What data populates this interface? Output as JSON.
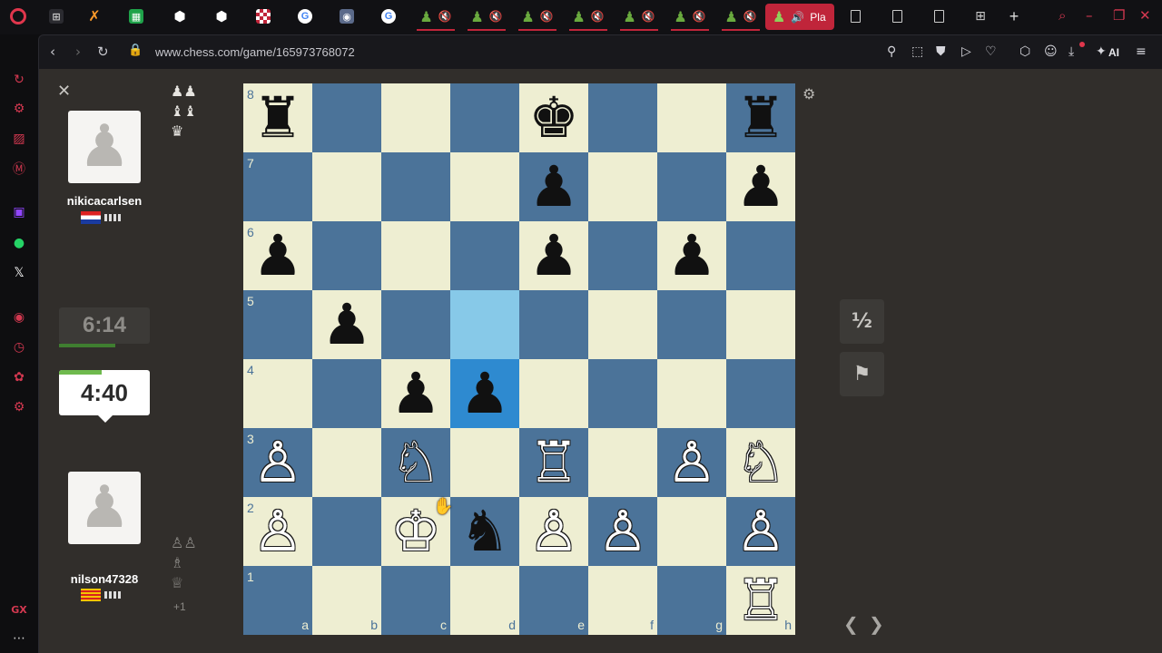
{
  "browser": {
    "active_tab_label": "Pla",
    "url": "www.chess.com/game/165973768072",
    "ai_label": "AI",
    "pawn_tab_glyph": "♟",
    "mute_glyph": "🔇"
  },
  "game": {
    "top_player": {
      "name": "nikicacarlsen",
      "clock": "6:14",
      "captured": [
        "♟♟",
        "♝♝",
        "♛"
      ]
    },
    "bottom_player": {
      "name": "nilson47328",
      "clock": "4:40",
      "captured": [
        "♙♙",
        "♗",
        "♕"
      ],
      "captured_extra": "+1"
    },
    "draw_label": "½",
    "ranks": [
      "8",
      "7",
      "6",
      "5",
      "4",
      "3",
      "2",
      "1"
    ],
    "files": [
      "a",
      "b",
      "c",
      "d",
      "e",
      "f",
      "g",
      "h"
    ],
    "pieces": [
      {
        "square": "a8",
        "glyph": "♜",
        "color": "b"
      },
      {
        "square": "e8",
        "glyph": "♚",
        "color": "b"
      },
      {
        "square": "h8",
        "glyph": "♜",
        "color": "b"
      },
      {
        "square": "e7",
        "glyph": "♟",
        "color": "b"
      },
      {
        "square": "h7",
        "glyph": "♟",
        "color": "b"
      },
      {
        "square": "a6",
        "glyph": "♟",
        "color": "b"
      },
      {
        "square": "e6",
        "glyph": "♟",
        "color": "b"
      },
      {
        "square": "g6",
        "glyph": "♟",
        "color": "b"
      },
      {
        "square": "b5",
        "glyph": "♟",
        "color": "b"
      },
      {
        "square": "c4",
        "glyph": "♟",
        "color": "b"
      },
      {
        "square": "d4",
        "glyph": "♟",
        "color": "b"
      },
      {
        "square": "a3",
        "glyph": "♙",
        "color": "w"
      },
      {
        "square": "c3",
        "glyph": "♘",
        "color": "w"
      },
      {
        "square": "e3",
        "glyph": "♖",
        "color": "w"
      },
      {
        "square": "g3",
        "glyph": "♙",
        "color": "w"
      },
      {
        "square": "h3",
        "glyph": "♘",
        "color": "w"
      },
      {
        "square": "a2",
        "glyph": "♙",
        "color": "w"
      },
      {
        "square": "c2",
        "glyph": "♔",
        "color": "w"
      },
      {
        "square": "d2",
        "glyph": "♞",
        "color": "b"
      },
      {
        "square": "e2",
        "glyph": "♙",
        "color": "w"
      },
      {
        "square": "f2",
        "glyph": "♙",
        "color": "w"
      },
      {
        "square": "h2",
        "glyph": "♙",
        "color": "w"
      },
      {
        "square": "h1",
        "glyph": "♖",
        "color": "w"
      }
    ],
    "last_move": {
      "from": "d5",
      "to": "d4"
    }
  },
  "colors": {
    "light_square": "#eeeed2",
    "dark_square": "#4b7399",
    "highlight_from": "#87c9e8",
    "highlight_to": "#2e8ad0",
    "brand_red": "#c0253a"
  }
}
